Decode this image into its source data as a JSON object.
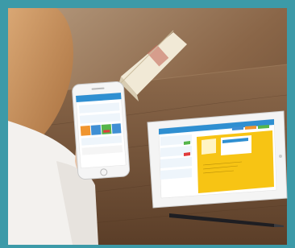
{
  "scene": {
    "description_hidden": "",
    "photo_border_color": "#3c9aa8",
    "table_color": "#7a5a3e",
    "wall_color": "#a3856a",
    "skin_color": "#e9c3a6",
    "hair_color": "#c98f5a",
    "shirt_color": "#f3f1ee",
    "accent_colors": {
      "ios_blue": "#2f8fd1",
      "tile_orange": "#f0952f",
      "tile_green": "#55b54a",
      "tile_blue": "#3f8fd4",
      "alert_red": "#e03b3b",
      "panel_yellow": "#f7c414"
    },
    "icons": [
      "phone-icon",
      "tablet-icon",
      "pen-icon",
      "book-icon"
    ]
  }
}
